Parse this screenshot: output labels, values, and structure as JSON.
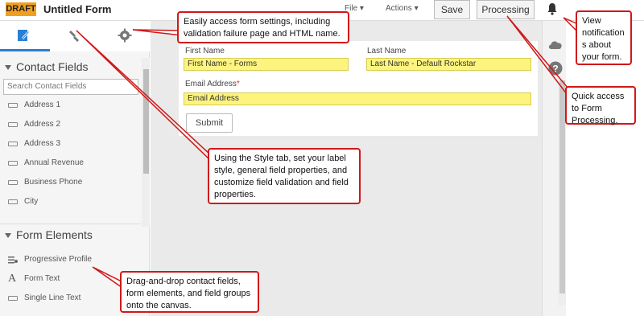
{
  "header": {
    "badge": "DRAFT",
    "title": "Untitled Form",
    "file_menu": "File ▾",
    "actions_menu": "Actions ▾",
    "save_label": "Save",
    "processing_label": "Processing"
  },
  "left_panel": {
    "contact_fields_heading": "Contact Fields",
    "search_placeholder": "Search Contact Fields",
    "contact_fields": [
      "Address 1",
      "Address 2",
      "Address 3",
      "Annual Revenue",
      "Business Phone",
      "City"
    ],
    "form_elements_heading": "Form Elements",
    "form_elements": [
      "Progressive Profile",
      "Form Text",
      "Single Line Text"
    ]
  },
  "form": {
    "first_name_label": "First Name",
    "first_name_value": "First Name - Forms",
    "last_name_label": "Last Name",
    "last_name_value": "Last Name - Default Rockstar",
    "email_label": "Email Address",
    "email_required_mark": "*",
    "email_value": "Email Address",
    "submit_label": "Submit"
  },
  "callouts": {
    "settings": "Easily access form settings, including validation failure page and HTML name.",
    "style": "Using the Style tab, set your label style, general field properties, and customize field validation and field properties.",
    "drag": "Drag-and-drop contact fields, form elements, and field groups onto the canvas.",
    "notifications": "View notification s about your form.",
    "processing": "Quick access to Form Processing."
  },
  "colors": {
    "badge": "#f0a020",
    "input_highlight": "#fdf480",
    "callout_border": "#d01818",
    "active_tab": "#2a7fd4"
  },
  "icons": [
    "pencil-icon",
    "paintbrush-icon",
    "gear-icon",
    "bell-icon",
    "cloud-icon",
    "help-icon",
    "field-icon",
    "progressive-profile-icon",
    "form-text-icon"
  ]
}
